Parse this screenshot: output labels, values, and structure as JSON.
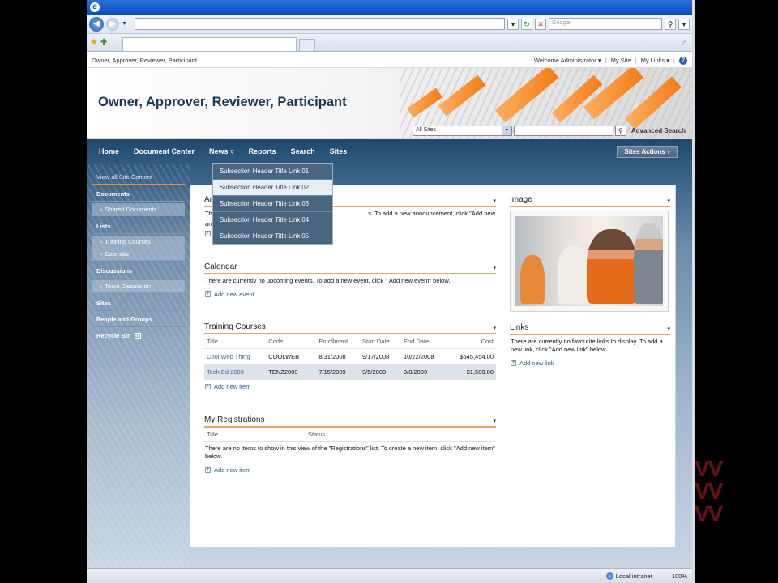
{
  "browser": {
    "search_placeholder": "Google",
    "status_zone": "Local intranet",
    "zoom": "100%",
    "icons": {
      "back": "back-arrow-icon",
      "forward": "forward-arrow-icon",
      "refresh": "refresh-icon",
      "stop": "stop-icon",
      "search": "search-icon",
      "favorites": "star-icon",
      "add_favorites": "add-favorite-icon",
      "home": "home-icon"
    }
  },
  "topbar": {
    "breadcrumb": "Owner, Approver, Reviewer, Participant",
    "welcome": "Welcome Administrator ▾",
    "my_site": "My Site",
    "my_links": "My Links ▾",
    "help": "?"
  },
  "banner": {
    "site_title": "Owner, Approver, Reviewer, Participant",
    "scope_value": "All Sites",
    "advanced_search": "Advanced Search",
    "accent": "#f27a14"
  },
  "topnav": {
    "items": [
      "Home",
      "Document Center",
      "News ▿",
      "Reports",
      "Search",
      "Sites"
    ],
    "sites_actions": "Sites Actions ▿",
    "color": "#21476b"
  },
  "news_dropdown": [
    "Subsection Header Title Link 01",
    "Subsection Header Title Link 02",
    "Subsection Header Title Link 03",
    "Subsection Header Title Link 04",
    "Subsection Header Title Link 05"
  ],
  "quicklaunch": {
    "view_all": "View all Site Content",
    "documents": "Documents",
    "documents_items": [
      "Shared Documents"
    ],
    "lists": "Lists",
    "lists_items": [
      "Training Courses",
      "Calendar"
    ],
    "discussions": "Discussions",
    "discussions_items": [
      "Team Discussion"
    ],
    "sites": "Sites",
    "people": "People and Groups",
    "recycle": "Recycle Bin"
  },
  "announcements": {
    "title_start": "An",
    "text_start": "Th",
    "text_end": "s. To add a new announcement, click \"Add new",
    "text_line2": "an"
  },
  "calendar": {
    "title": "Calendar",
    "text": "There are currently no upcoming events. To add a new event, click \" Add new event\" below.",
    "add": "Add new event"
  },
  "training": {
    "title": "Training Courses",
    "columns": [
      "Title",
      "Code",
      "Enrollment",
      "Start Date",
      "End Date",
      "Cost"
    ],
    "rows": [
      [
        "Cool Web Thing",
        "COOLWEBT",
        "8/31/2008",
        "9/17/2008",
        "10/22/2008",
        "$545,454.00"
      ],
      [
        "Tech Ed 2009",
        "TENZ2009",
        "7/15/2009",
        "9/5/2009",
        "9/8/2009",
        "$1,500.00"
      ]
    ],
    "add": "Add new item"
  },
  "registrations": {
    "title": "My Registrations",
    "columns": [
      "Title",
      "Status"
    ],
    "text": "There are no items to show in this view of the \"Registrations\" list. To create a new item, click \"Add new item\" below.",
    "add": "Add new item"
  },
  "image_part": {
    "title": "Image"
  },
  "links_part": {
    "title": "Links",
    "text": "There are currently no favourite links to display. To add a new link, click \"Add new link\" below.",
    "add": "Add new link"
  },
  "webpart_menu_glyph": "▾",
  "add_glyph": "+",
  "scope_caret": "▾",
  "search_glyph": "⚲"
}
